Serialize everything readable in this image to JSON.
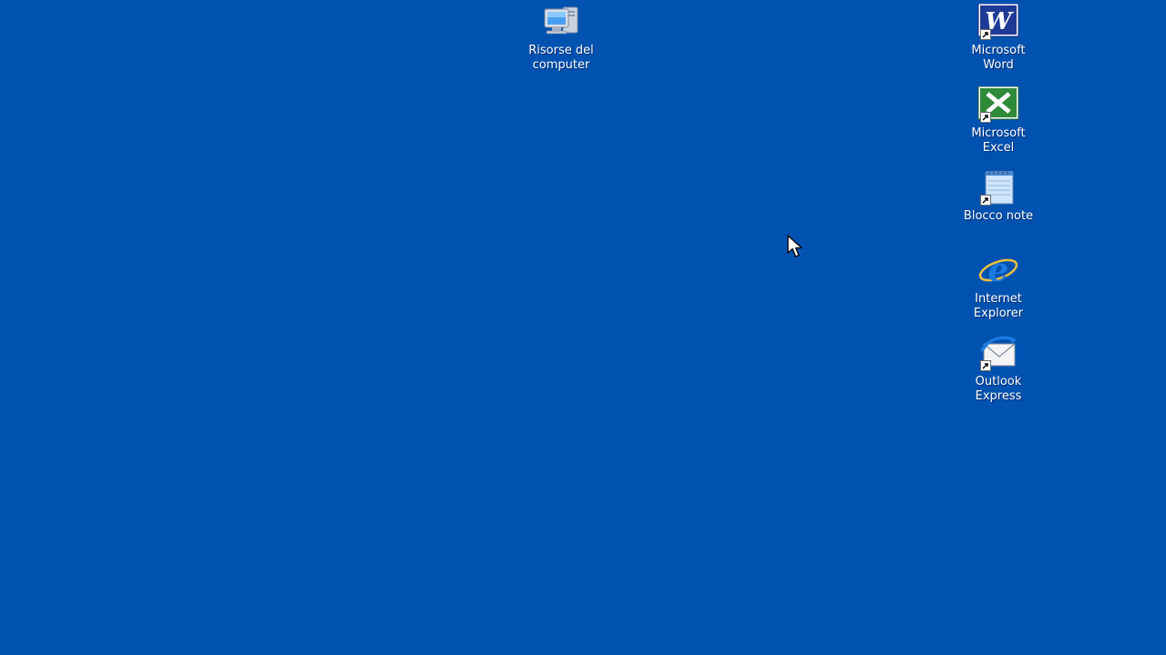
{
  "desktop": {
    "background_color": "#0052b0",
    "icons": [
      {
        "label": "Risorse del\ncomputer",
        "icon": "my-computer-icon",
        "shortcut": false
      },
      {
        "label": "Microsoft\nWord",
        "icon": "word-icon",
        "shortcut": true
      },
      {
        "label": "Microsoft\nExcel",
        "icon": "excel-icon",
        "shortcut": true
      },
      {
        "label": "Blocco note",
        "icon": "notepad-icon",
        "shortcut": true
      },
      {
        "label": "Internet\nExplorer",
        "icon": "internet-explorer-icon",
        "shortcut": false
      },
      {
        "label": "Outlook\nExpress",
        "icon": "outlook-express-icon",
        "shortcut": true
      }
    ]
  },
  "pointer": {
    "icon": "mouse-pointer-icon"
  }
}
